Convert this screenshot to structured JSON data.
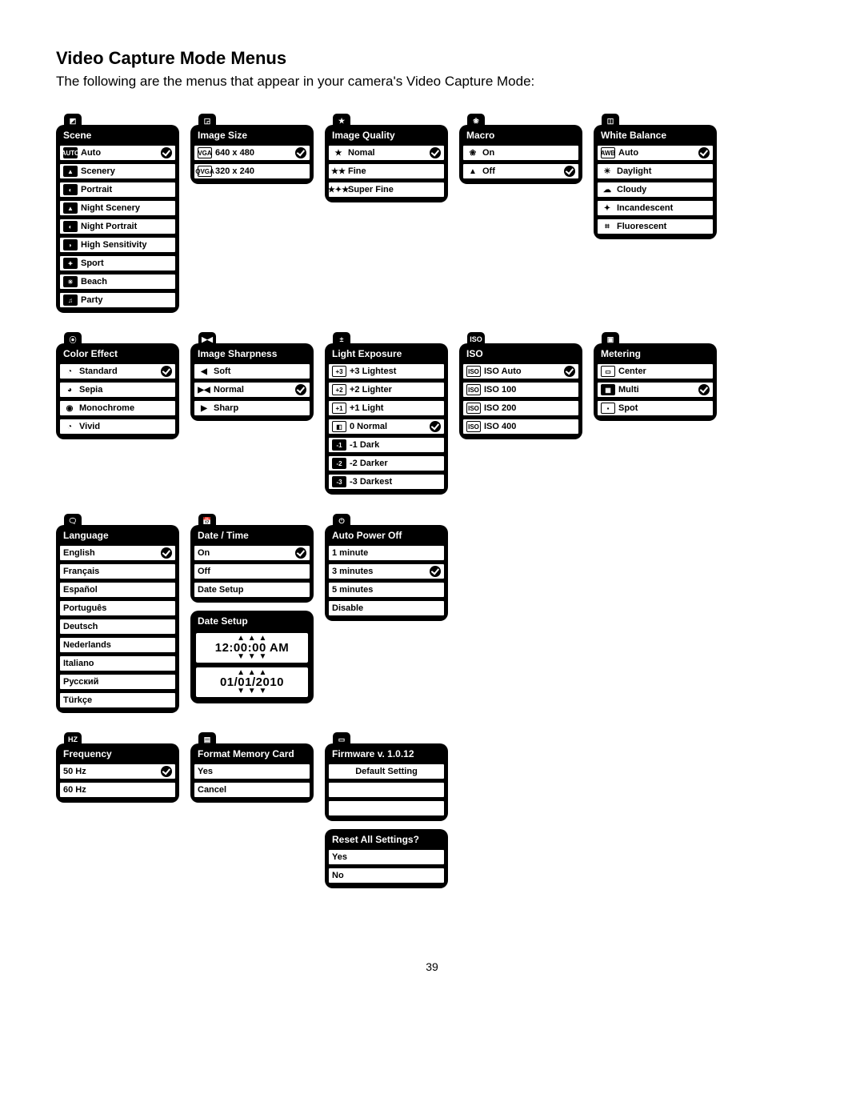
{
  "heading": "Video Capture Mode Menus",
  "intro": "The following are the menus that appear in your camera's Video Capture Mode:",
  "page_number": "39",
  "menus": {
    "scene": {
      "title": "Scene",
      "items": [
        "Auto",
        "Scenery",
        "Portrait",
        "Night Scenery",
        "Night Portrait",
        "High Sensitivity",
        "Sport",
        "Beach",
        "Party"
      ],
      "selected": 0
    },
    "image_size": {
      "title": "Image Size",
      "items": [
        "640 x 480",
        "320 x 240"
      ],
      "prefix": [
        "VGA",
        "QVGA"
      ],
      "selected": 0
    },
    "image_quality": {
      "title": "Image Quality",
      "items": [
        "Nomal",
        "Fine",
        "Super Fine"
      ],
      "selected": 0
    },
    "macro": {
      "title": "Macro",
      "items": [
        "On",
        "Off"
      ],
      "selected": 1
    },
    "white_balance": {
      "title": "White Balance",
      "items": [
        "Auto",
        "Daylight",
        "Cloudy",
        "Incandescent",
        "Fluorescent"
      ],
      "selected": 0
    },
    "color_effect": {
      "title": "Color Effect",
      "items": [
        "Standard",
        "Sepia",
        "Monochrome",
        "Vivid"
      ],
      "selected": 0
    },
    "image_sharpness": {
      "title": "Image Sharpness",
      "items": [
        "Soft",
        "Normal",
        "Sharp"
      ],
      "selected": 1
    },
    "light_exposure": {
      "title": "Light Exposure",
      "items": [
        "+3 Lightest",
        "+2 Lighter",
        "+1 Light",
        "0 Normal",
        "-1 Dark",
        "-2 Darker",
        "-3 Darkest"
      ],
      "selected": 3
    },
    "iso": {
      "title": "ISO",
      "items": [
        "ISO Auto",
        "ISO 100",
        "ISO 200",
        "ISO 400"
      ],
      "selected": 0
    },
    "metering": {
      "title": "Metering",
      "items": [
        "Center",
        "Multi",
        "Spot"
      ],
      "selected": 1
    },
    "language": {
      "title": "Language",
      "items": [
        "English",
        "Français",
        "Español",
        "Português",
        "Deutsch",
        "Nederlands",
        "Italiano",
        "Русский",
        "Türkçe"
      ],
      "selected": 0
    },
    "date_time": {
      "title": "Date / Time",
      "items": [
        "On",
        "Off",
        "Date Setup"
      ],
      "selected": 0
    },
    "date_setup": {
      "title": "Date Setup",
      "time": "12:00:00 AM",
      "date": "01/01/2010"
    },
    "auto_power_off": {
      "title": "Auto Power Off",
      "items": [
        "1 minute",
        "3 minutes",
        "5 minutes",
        "Disable"
      ],
      "selected": 1
    },
    "frequency": {
      "title": "Frequency",
      "items": [
        "50 Hz",
        "60 Hz"
      ],
      "selected": 0
    },
    "format_memory": {
      "title": "Format Memory Card",
      "items": [
        "Yes",
        "Cancel"
      ]
    },
    "firmware": {
      "title": "Firmware v. 1.0.12",
      "items": [
        "Default Setting",
        "",
        ""
      ]
    },
    "reset": {
      "title": "Reset All Settings?",
      "items": [
        "Yes",
        "No"
      ]
    }
  },
  "icons": {
    "scene": [
      "AUTO",
      "▲",
      "◐",
      "▲",
      "◐",
      "◗",
      "✦",
      "☀",
      "♫"
    ],
    "image_quality": [
      "★",
      "★★",
      "★✦★"
    ],
    "macro": [
      "❀",
      "▲"
    ],
    "white_balance": [
      "AWB",
      "☀",
      "☁",
      "✦",
      "⌗"
    ],
    "color_effect": [
      "◔",
      "◕",
      "◉",
      "◔"
    ],
    "image_sharpness": [
      "◀",
      "▶◀",
      "▶"
    ],
    "light_exposure": [
      "+3",
      "+2",
      "+1",
      "◧",
      "-1",
      "-2",
      "-3"
    ],
    "iso": [
      "ISO",
      "ISO",
      "ISO",
      "ISO"
    ],
    "iso_sub": [
      "AUTO",
      "100",
      "200",
      "400"
    ],
    "metering": [
      "▭",
      "▦",
      "▪"
    ]
  }
}
